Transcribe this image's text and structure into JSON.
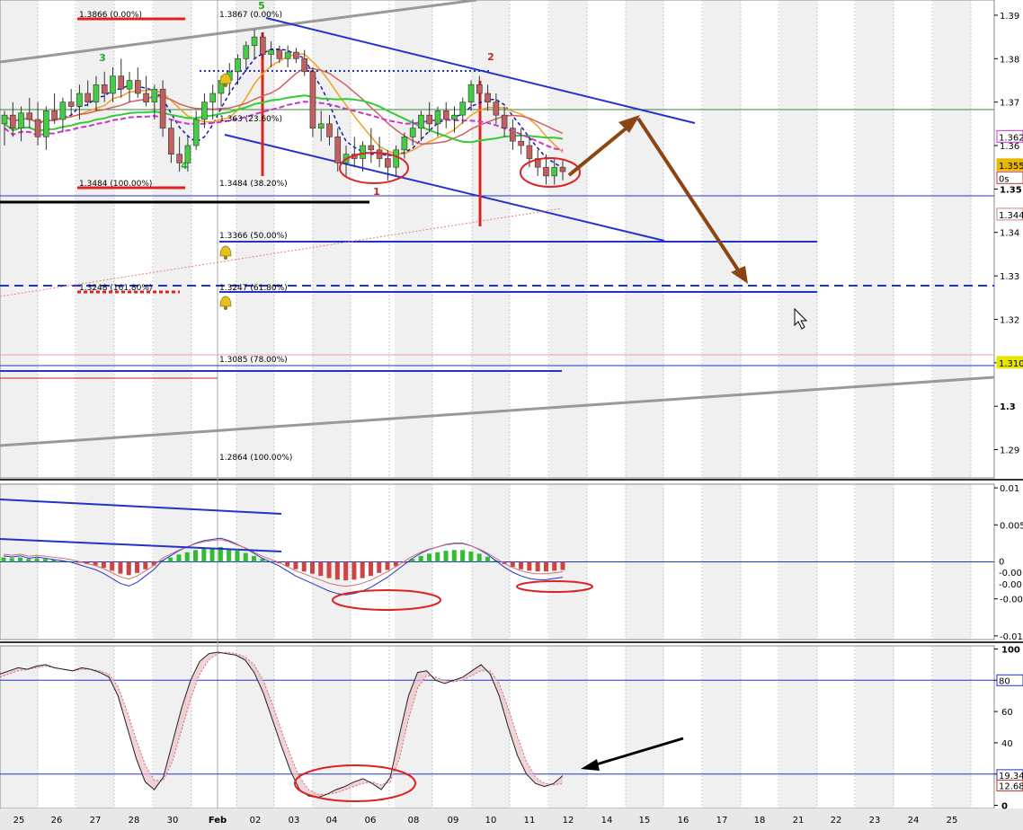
{
  "chart_data": [
    {
      "type": "candlestick",
      "panel": "price",
      "y_axis_ticks": [
        "1.39",
        "1.38",
        "1.37",
        "1.36",
        "1.35",
        "1.34",
        "1.33",
        "1.32",
        "1.31",
        "1.3",
        "1.29"
      ],
      "ylim": [
        1.2835,
        1.3935
      ],
      "x_tick_labels": [
        "25",
        "26",
        "27",
        "28",
        "30",
        "Feb",
        "02",
        "03",
        "04",
        "06",
        "08",
        "09",
        "10",
        "11",
        "12",
        "14",
        "15",
        "16",
        "17",
        "18",
        "21",
        "22",
        "23",
        "24",
        "25"
      ],
      "price_tags": [
        {
          "label": "1.362",
          "value": 1.362,
          "color": "#cc33cc"
        },
        {
          "label": "1.355",
          "value": 1.3555,
          "color": "#e6b800"
        },
        {
          "label": "0s",
          "value": 1.3525,
          "color": "#cc3333"
        },
        {
          "label": "1.344",
          "value": 1.3441,
          "color": "#d08080"
        },
        {
          "label": "1.310",
          "value": 1.31,
          "color": "#e6e600"
        }
      ],
      "fib_labels": [
        {
          "text": "1.3866 (0.00%)",
          "value": 1.3866
        },
        {
          "text": "1.3484 (100.00%)",
          "value": 1.3484
        },
        {
          "text": "1.3248 (161.80%)",
          "value": 1.3248
        },
        {
          "text": "1.3867 (0.00%)",
          "value": 1.3867
        },
        {
          "text": "1.363 (23.60%)",
          "value": 1.363
        },
        {
          "text": "1.3484 (38.20%)",
          "value": 1.3484
        },
        {
          "text": "1.3366 (50.00%)",
          "value": 1.3366
        },
        {
          "text": "1.3247 (61.80%)",
          "value": 1.3247
        },
        {
          "text": "1.3085 (78.00%)",
          "value": 1.3085
        },
        {
          "text": "1.2864 (100.00%)",
          "value": 1.2864
        }
      ],
      "wave_labels": [
        {
          "text": "3",
          "color": "#22aa22"
        },
        {
          "text": "4",
          "color": "#22aa22"
        },
        {
          "text": "5",
          "color": "#22aa22"
        },
        {
          "text": "1",
          "color": "#cc2222"
        },
        {
          "text": "2",
          "color": "#cc2222"
        }
      ],
      "candles": [
        {
          "o": 1.365,
          "h": 1.368,
          "l": 1.36,
          "c": 1.367
        },
        {
          "o": 1.367,
          "h": 1.37,
          "l": 1.362,
          "c": 1.364
        },
        {
          "o": 1.364,
          "h": 1.369,
          "l": 1.361,
          "c": 1.3675
        },
        {
          "o": 1.3675,
          "h": 1.371,
          "l": 1.364,
          "c": 1.366
        },
        {
          "o": 1.366,
          "h": 1.37,
          "l": 1.36,
          "c": 1.362
        },
        {
          "o": 1.362,
          "h": 1.369,
          "l": 1.359,
          "c": 1.368
        },
        {
          "o": 1.368,
          "h": 1.372,
          "l": 1.365,
          "c": 1.366
        },
        {
          "o": 1.366,
          "h": 1.371,
          "l": 1.363,
          "c": 1.37
        },
        {
          "o": 1.37,
          "h": 1.373,
          "l": 1.367,
          "c": 1.369
        },
        {
          "o": 1.369,
          "h": 1.374,
          "l": 1.366,
          "c": 1.372
        },
        {
          "o": 1.372,
          "h": 1.375,
          "l": 1.369,
          "c": 1.37
        },
        {
          "o": 1.37,
          "h": 1.376,
          "l": 1.368,
          "c": 1.374
        },
        {
          "o": 1.374,
          "h": 1.377,
          "l": 1.37,
          "c": 1.372
        },
        {
          "o": 1.372,
          "h": 1.378,
          "l": 1.37,
          "c": 1.376
        },
        {
          "o": 1.376,
          "h": 1.38,
          "l": 1.371,
          "c": 1.373
        },
        {
          "o": 1.373,
          "h": 1.377,
          "l": 1.37,
          "c": 1.375
        },
        {
          "o": 1.375,
          "h": 1.378,
          "l": 1.371,
          "c": 1.372
        },
        {
          "o": 1.372,
          "h": 1.376,
          "l": 1.369,
          "c": 1.37
        },
        {
          "o": 1.37,
          "h": 1.374,
          "l": 1.366,
          "c": 1.373
        },
        {
          "o": 1.373,
          "h": 1.375,
          "l": 1.362,
          "c": 1.364
        },
        {
          "o": 1.364,
          "h": 1.366,
          "l": 1.356,
          "c": 1.358
        },
        {
          "o": 1.358,
          "h": 1.362,
          "l": 1.354,
          "c": 1.356
        },
        {
          "o": 1.356,
          "h": 1.362,
          "l": 1.354,
          "c": 1.36
        },
        {
          "o": 1.36,
          "h": 1.368,
          "l": 1.359,
          "c": 1.366
        },
        {
          "o": 1.366,
          "h": 1.372,
          "l": 1.364,
          "c": 1.37
        },
        {
          "o": 1.37,
          "h": 1.374,
          "l": 1.366,
          "c": 1.372
        },
        {
          "o": 1.372,
          "h": 1.376,
          "l": 1.369,
          "c": 1.375
        },
        {
          "o": 1.375,
          "h": 1.379,
          "l": 1.372,
          "c": 1.377
        },
        {
          "o": 1.377,
          "h": 1.381,
          "l": 1.374,
          "c": 1.38
        },
        {
          "o": 1.38,
          "h": 1.384,
          "l": 1.377,
          "c": 1.383
        },
        {
          "o": 1.383,
          "h": 1.3867,
          "l": 1.38,
          "c": 1.385
        },
        {
          "o": 1.385,
          "h": 1.386,
          "l": 1.38,
          "c": 1.381
        },
        {
          "o": 1.381,
          "h": 1.384,
          "l": 1.378,
          "c": 1.382
        },
        {
          "o": 1.382,
          "h": 1.383,
          "l": 1.379,
          "c": 1.38
        },
        {
          "o": 1.38,
          "h": 1.383,
          "l": 1.378,
          "c": 1.3815
        },
        {
          "o": 1.3815,
          "h": 1.3825,
          "l": 1.379,
          "c": 1.38
        },
        {
          "o": 1.38,
          "h": 1.382,
          "l": 1.376,
          "c": 1.377
        },
        {
          "o": 1.377,
          "h": 1.378,
          "l": 1.362,
          "c": 1.364
        },
        {
          "o": 1.364,
          "h": 1.368,
          "l": 1.361,
          "c": 1.365
        },
        {
          "o": 1.365,
          "h": 1.367,
          "l": 1.36,
          "c": 1.362
        },
        {
          "o": 1.362,
          "h": 1.364,
          "l": 1.354,
          "c": 1.356
        },
        {
          "o": 1.356,
          "h": 1.36,
          "l": 1.353,
          "c": 1.358
        },
        {
          "o": 1.358,
          "h": 1.362,
          "l": 1.355,
          "c": 1.357
        },
        {
          "o": 1.357,
          "h": 1.361,
          "l": 1.354,
          "c": 1.36
        },
        {
          "o": 1.36,
          "h": 1.364,
          "l": 1.356,
          "c": 1.359
        },
        {
          "o": 1.359,
          "h": 1.362,
          "l": 1.355,
          "c": 1.357
        },
        {
          "o": 1.357,
          "h": 1.359,
          "l": 1.352,
          "c": 1.355
        },
        {
          "o": 1.355,
          "h": 1.36,
          "l": 1.353,
          "c": 1.359
        },
        {
          "o": 1.359,
          "h": 1.363,
          "l": 1.357,
          "c": 1.362
        },
        {
          "o": 1.362,
          "h": 1.366,
          "l": 1.36,
          "c": 1.364
        },
        {
          "o": 1.364,
          "h": 1.368,
          "l": 1.361,
          "c": 1.367
        },
        {
          "o": 1.367,
          "h": 1.37,
          "l": 1.363,
          "c": 1.365
        },
        {
          "o": 1.365,
          "h": 1.369,
          "l": 1.362,
          "c": 1.368
        },
        {
          "o": 1.368,
          "h": 1.37,
          "l": 1.364,
          "c": 1.366
        },
        {
          "o": 1.366,
          "h": 1.369,
          "l": 1.363,
          "c": 1.367
        },
        {
          "o": 1.367,
          "h": 1.371,
          "l": 1.365,
          "c": 1.37
        },
        {
          "o": 1.37,
          "h": 1.375,
          "l": 1.368,
          "c": 1.374
        },
        {
          "o": 1.374,
          "h": 1.376,
          "l": 1.37,
          "c": 1.372
        },
        {
          "o": 1.372,
          "h": 1.374,
          "l": 1.368,
          "c": 1.37
        },
        {
          "o": 1.37,
          "h": 1.372,
          "l": 1.365,
          "c": 1.367
        },
        {
          "o": 1.367,
          "h": 1.369,
          "l": 1.362,
          "c": 1.364
        },
        {
          "o": 1.364,
          "h": 1.366,
          "l": 1.359,
          "c": 1.361
        },
        {
          "o": 1.361,
          "h": 1.364,
          "l": 1.358,
          "c": 1.36
        },
        {
          "o": 1.36,
          "h": 1.362,
          "l": 1.355,
          "c": 1.357
        },
        {
          "o": 1.357,
          "h": 1.359,
          "l": 1.353,
          "c": 1.355
        },
        {
          "o": 1.355,
          "h": 1.358,
          "l": 1.351,
          "c": 1.353
        },
        {
          "o": 1.353,
          "h": 1.357,
          "l": 1.351,
          "c": 1.355
        },
        {
          "o": 1.355,
          "h": 1.357,
          "l": 1.352,
          "c": 1.354
        }
      ]
    },
    {
      "type": "histogram",
      "panel": "macd",
      "y_axis_ticks": [
        "0.01",
        "0.005",
        "-0.005",
        "-0.01"
      ],
      "ylim": [
        -0.0105,
        0.0105
      ],
      "zero_tag": "0",
      "right_tags": [
        "-0.00",
        "-0.00"
      ],
      "values": [
        0.0006,
        0.0005,
        0.0006,
        0.0004,
        0.0005,
        0.0004,
        0.0003,
        0.0002,
        0.0001,
        -0.0001,
        -0.0003,
        -0.0005,
        -0.0008,
        -0.0012,
        -0.0016,
        -0.0018,
        -0.0015,
        -0.001,
        -0.0005,
        0.0002,
        0.0006,
        0.001,
        0.0013,
        0.0016,
        0.0018,
        0.0019,
        0.002,
        0.0018,
        0.0015,
        0.0012,
        0.0008,
        0.0004,
        0.0001,
        -0.0002,
        -0.0006,
        -0.001,
        -0.0013,
        -0.0016,
        -0.0019,
        -0.0022,
        -0.0024,
        -0.0025,
        -0.0024,
        -0.0022,
        -0.0019,
        -0.0015,
        -0.0011,
        -0.0006,
        -0.0001,
        0.0004,
        0.0008,
        0.0011,
        0.0013,
        0.0015,
        0.0016,
        0.0016,
        0.0014,
        0.0011,
        0.0007,
        0.0002,
        -0.0003,
        -0.0007,
        -0.001,
        -0.0012,
        -0.0013,
        -0.0013,
        -0.0012,
        -0.0011
      ]
    },
    {
      "type": "line",
      "panel": "stochastic",
      "y_axis_ticks": [
        "100",
        "80",
        "60",
        "40",
        "20",
        "0"
      ],
      "ylim": [
        -2,
        102
      ],
      "right_tags": [
        "80",
        "19.34",
        "12.68"
      ],
      "series": [
        {
          "values": [
            84,
            86,
            88,
            87,
            89,
            90,
            88,
            87,
            86,
            88,
            87,
            85,
            82,
            70,
            50,
            30,
            15,
            10,
            18,
            40,
            62,
            80,
            92,
            97,
            98,
            97,
            96,
            93,
            85,
            72,
            55,
            38,
            22,
            10,
            6,
            5,
            7,
            10,
            12,
            15,
            17,
            14,
            10,
            18,
            45,
            70,
            85,
            86,
            80,
            78,
            80,
            82,
            86,
            90,
            84,
            70,
            50,
            32,
            20,
            14,
            12,
            14,
            19
          ]
        },
        {
          "values": [
            82,
            84,
            86,
            87,
            88,
            89,
            88,
            87,
            86,
            87,
            87,
            86,
            84,
            76,
            60,
            42,
            26,
            16,
            16,
            28,
            48,
            68,
            84,
            93,
            97,
            98,
            97,
            95,
            90,
            80,
            65,
            48,
            32,
            18,
            10,
            7,
            7,
            8,
            10,
            12,
            14,
            15,
            13,
            15,
            30,
            55,
            75,
            83,
            82,
            80,
            79,
            80,
            83,
            86,
            86,
            78,
            62,
            44,
            28,
            18,
            14,
            13,
            14
          ]
        }
      ]
    }
  ]
}
